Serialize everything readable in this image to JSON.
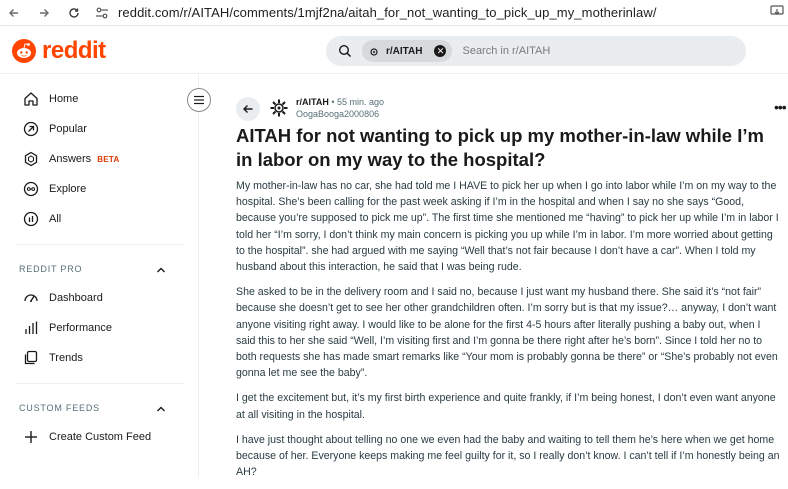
{
  "browser": {
    "url": "reddit.com/r/AITAH/comments/1mjf2na/aitah_for_not_wanting_to_pick_up_my_motherinlaw/"
  },
  "header": {
    "logo_text": "reddit",
    "search": {
      "chip_label": "r/AITAH",
      "placeholder": "Search in r/AITAH"
    }
  },
  "sidebar": {
    "items": [
      {
        "label": "Home",
        "icon": "home-icon"
      },
      {
        "label": "Popular",
        "icon": "popular-icon"
      },
      {
        "label": "Answers",
        "icon": "answers-icon",
        "badge": "BETA"
      },
      {
        "label": "Explore",
        "icon": "explore-icon"
      },
      {
        "label": "All",
        "icon": "all-icon"
      }
    ],
    "reddit_pro": {
      "heading": "REDDIT PRO",
      "items": [
        {
          "label": "Dashboard",
          "icon": "dashboard-icon"
        },
        {
          "label": "Performance",
          "icon": "performance-icon"
        },
        {
          "label": "Trends",
          "icon": "trends-icon"
        }
      ]
    },
    "custom_feeds": {
      "heading": "CUSTOM FEEDS",
      "items": [
        {
          "label": "Create Custom Feed",
          "icon": "plus-icon"
        }
      ]
    }
  },
  "post": {
    "subreddit": "r/AITAH",
    "time": "55 min. ago",
    "author": "OogaBooga2000806",
    "title": "AITAH for not wanting to pick up my mother-in-law while I’m in labor on my way to the hospital?",
    "paragraphs": [
      "My mother-in-law has no car, she had told me I HAVE to pick her up when I go into labor while I’m on my way to the hospital. She’s been calling for the past week asking if I’m in the hospital and when I say no she says “Good, because you’re supposed to pick me up”. The first time she mentioned me “having” to pick her up while I’m in labor I told her “I’m sorry, I don’t think my main concern is picking you up while I’m in labor. I’m more worried about getting to the hospital”.  she had argued with me saying “Well that’s not fair because I don’t have a car”. When I told my husband about this interaction, he said that I was being rude.",
      "She asked to be in the delivery room and I said no, because I just want my husband there. She said it’s “not fair” because she doesn’t get to see her other grandchildren often. I’m sorry but is that my issue?… anyway, I don’t want anyone visiting right away. I would like to be alone for the first 4-5 hours after literally pushing a baby out, when I said this to her she said “Well, I’m visiting first and I’m gonna be there right after he’s born”. Since I told her no to both requests she has made smart remarks like “Your mom is probably gonna be there” or “She’s probably not even gonna let me see the baby”.",
      "I get the excitement but, it’s my first birth experience and quite frankly, if I’m being honest, I don’t even want anyone at all visiting in the hospital.",
      "I have just thought about telling no one we even had the baby and waiting to tell them he’s here when we get home because of her. Everyone keeps making me feel guilty for it, so I really don’t know. I can’t tell if I’m honestly being an AH?"
    ]
  },
  "colors": {
    "brand": "#ff4500",
    "beta": "#d93a00",
    "text": "#1a1a1b",
    "muted": "#576f76"
  }
}
